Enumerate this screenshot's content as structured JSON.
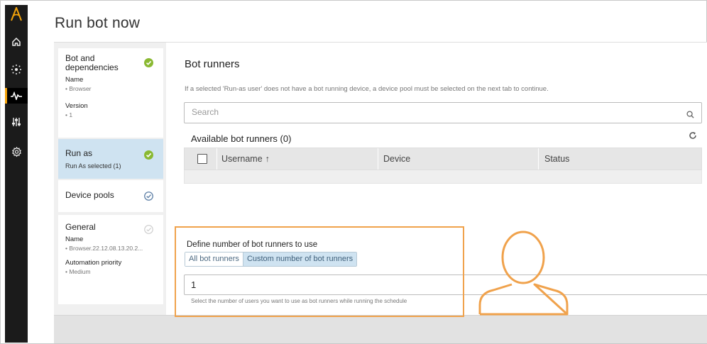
{
  "page": {
    "title": "Run bot now"
  },
  "rail": {
    "icons": [
      "home-icon",
      "dashboard-icon",
      "activity-icon",
      "settings-sliders-icon",
      "gear-icon"
    ],
    "accent": "#f4a30a"
  },
  "steps": {
    "bot": {
      "title": "Bot and dependencies",
      "name_key": "Name",
      "name_val": "• Browser",
      "version_key": "Version",
      "version_val": "• 1"
    },
    "runas": {
      "title": "Run as",
      "sub": "Run As selected (1)"
    },
    "pools": {
      "title": "Device pools"
    },
    "general": {
      "title": "General",
      "name_key": "Name",
      "name_val": "• Browser.22.12.08.13.20.2...",
      "prio_key": "Automation priority",
      "prio_val": "• Medium"
    }
  },
  "panel": {
    "title": "Bot runners",
    "note": "If a selected 'Run-as user' does not have a bot running device, a device pool must be selected on the next tab to continue.",
    "search_placeholder": "Search",
    "available_label": "Available bot runners (0)",
    "columns": {
      "username": "Username",
      "sort_arrow": "↑",
      "device": "Device",
      "status": "Status"
    },
    "define_label": "Define number of bot runners to use",
    "options": {
      "all": "All bot runners",
      "custom": "Custom number of bot runners"
    },
    "count_value": "1",
    "hint": "Select the number of users you want to use as bot runners while running the schedule"
  },
  "colors": {
    "check_green": "#8ab932",
    "check_blue": "#5d7fa6",
    "highlight": "#f0a24c",
    "selected_step": "#cfe3f1"
  }
}
